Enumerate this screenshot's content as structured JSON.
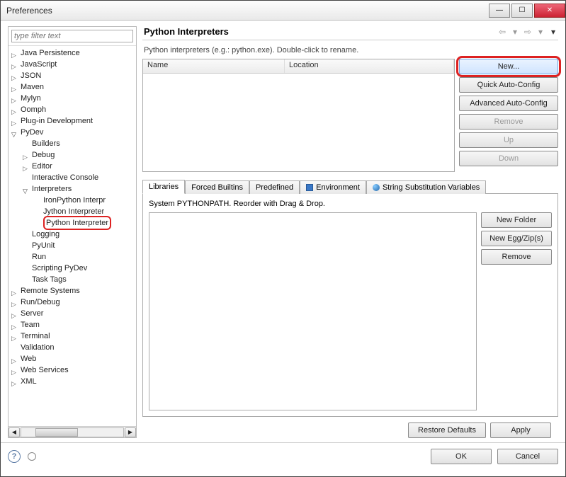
{
  "window": {
    "title": "Preferences"
  },
  "filter": {
    "placeholder": "type filter text"
  },
  "tree": [
    {
      "label": "Java Persistence",
      "depth": 0,
      "arrow": "closed"
    },
    {
      "label": "JavaScript",
      "depth": 0,
      "arrow": "closed"
    },
    {
      "label": "JSON",
      "depth": 0,
      "arrow": "closed"
    },
    {
      "label": "Maven",
      "depth": 0,
      "arrow": "closed"
    },
    {
      "label": "Mylyn",
      "depth": 0,
      "arrow": "closed"
    },
    {
      "label": "Oomph",
      "depth": 0,
      "arrow": "closed"
    },
    {
      "label": "Plug-in Development",
      "depth": 0,
      "arrow": "closed"
    },
    {
      "label": "PyDev",
      "depth": 0,
      "arrow": "open"
    },
    {
      "label": "Builders",
      "depth": 1,
      "arrow": "none"
    },
    {
      "label": "Debug",
      "depth": 1,
      "arrow": "closed"
    },
    {
      "label": "Editor",
      "depth": 1,
      "arrow": "closed"
    },
    {
      "label": "Interactive Console",
      "depth": 1,
      "arrow": "none"
    },
    {
      "label": "Interpreters",
      "depth": 1,
      "arrow": "open"
    },
    {
      "label": "IronPython Interpr",
      "depth": 2,
      "arrow": "none"
    },
    {
      "label": "Jython Interpreter",
      "depth": 2,
      "arrow": "none"
    },
    {
      "label": "Python Interpreter",
      "depth": 2,
      "arrow": "none",
      "highlighted": true
    },
    {
      "label": "Logging",
      "depth": 1,
      "arrow": "none"
    },
    {
      "label": "PyUnit",
      "depth": 1,
      "arrow": "none"
    },
    {
      "label": "Run",
      "depth": 1,
      "arrow": "none"
    },
    {
      "label": "Scripting PyDev",
      "depth": 1,
      "arrow": "none"
    },
    {
      "label": "Task Tags",
      "depth": 1,
      "arrow": "none"
    },
    {
      "label": "Remote Systems",
      "depth": 0,
      "arrow": "closed"
    },
    {
      "label": "Run/Debug",
      "depth": 0,
      "arrow": "closed"
    },
    {
      "label": "Server",
      "depth": 0,
      "arrow": "closed"
    },
    {
      "label": "Team",
      "depth": 0,
      "arrow": "closed"
    },
    {
      "label": "Terminal",
      "depth": 0,
      "arrow": "closed"
    },
    {
      "label": "Validation",
      "depth": 0,
      "arrow": "none"
    },
    {
      "label": "Web",
      "depth": 0,
      "arrow": "closed"
    },
    {
      "label": "Web Services",
      "depth": 0,
      "arrow": "closed"
    },
    {
      "label": "XML",
      "depth": 0,
      "arrow": "closed"
    }
  ],
  "page": {
    "title": "Python Interpreters",
    "desc": "Python interpreters (e.g.: python.exe).   Double-click to rename."
  },
  "table": {
    "headers": {
      "name": "Name",
      "location": "Location"
    }
  },
  "buttons": {
    "new": "New...",
    "quick": "Quick Auto-Config",
    "advanced": "Advanced Auto-Config",
    "remove": "Remove",
    "up": "Up",
    "down": "Down"
  },
  "tabs": {
    "libraries": "Libraries",
    "forced": "Forced Builtins",
    "predefined": "Predefined",
    "environment": "Environment",
    "substitution": "String Substitution Variables"
  },
  "panel": {
    "desc": "System PYTHONPATH.   Reorder with Drag & Drop.",
    "new_folder": "New Folder",
    "new_egg": "New Egg/Zip(s)",
    "remove": "Remove"
  },
  "footer": {
    "restore": "Restore Defaults",
    "apply": "Apply",
    "ok": "OK",
    "cancel": "Cancel"
  }
}
